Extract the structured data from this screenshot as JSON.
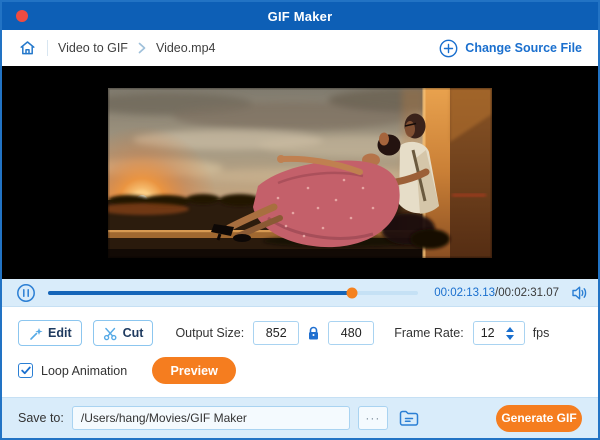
{
  "titlebar": {
    "title": "GIF Maker"
  },
  "breadcrumb": {
    "level1": "Video to GIF",
    "level2": "Video.mp4",
    "change_source_label": "Change Source File"
  },
  "player": {
    "current_time": "00:02:13.13",
    "time_separator": "/",
    "total_time": "00:02:31.07",
    "progress_percent": 82
  },
  "controls": {
    "edit_label": "Edit",
    "cut_label": "Cut",
    "output_size_label": "Output Size:",
    "output_width": "852",
    "output_height": "480",
    "frame_rate_label": "Frame Rate:",
    "frame_rate_value": "12",
    "fps_label": "fps",
    "loop_label": "Loop Animation",
    "loop_checked": true,
    "preview_label": "Preview"
  },
  "footer": {
    "save_to_label": "Save to:",
    "save_path": "/Users/hang/Movies/GIF Maker",
    "browse_label": "···",
    "generate_label": "Generate GIF"
  },
  "colors": {
    "titlebar_blue": "#0d5fb6",
    "accent_blue": "#1a6fce",
    "accent_orange": "#f57d1f",
    "panel_light_blue": "#d9ecfa",
    "progress_fill": "#1565b8",
    "progress_thumb": "#f5821f",
    "window_border": "#2273c4"
  }
}
